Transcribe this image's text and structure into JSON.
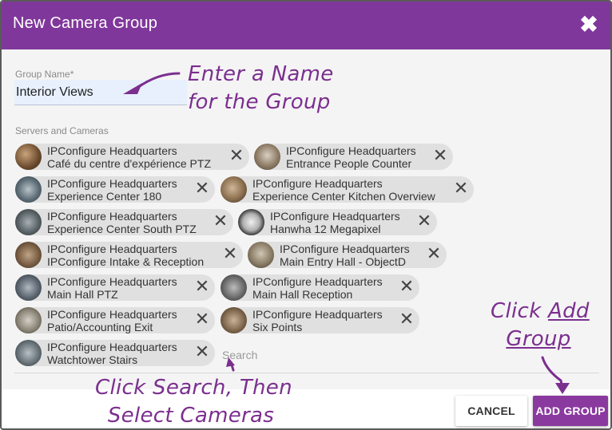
{
  "dialog": {
    "title": "New Camera Group",
    "close_icon": "close-icon"
  },
  "form": {
    "group_name_label": "Group Name",
    "group_name_required_mark": "*",
    "group_name_value": "Interior Views",
    "servers_label": "Servers and Cameras",
    "search_placeholder": "Search"
  },
  "cameras": [
    {
      "server": "IPConfigure Headquarters",
      "camera": "Café du centre d'expérience PTZ"
    },
    {
      "server": "IPConfigure Headquarters",
      "camera": "Entrance People Counter"
    },
    {
      "server": "IPConfigure Headquarters",
      "camera": "Experience Center 180"
    },
    {
      "server": "IPConfigure Headquarters",
      "camera": "Experience Center Kitchen Overview"
    },
    {
      "server": "IPConfigure Headquarters",
      "camera": "Experience Center South PTZ"
    },
    {
      "server": "IPConfigure Headquarters",
      "camera": "Hanwha 12 Megapixel"
    },
    {
      "server": "IPConfigure Headquarters",
      "camera": "IPConfigure Intake & Reception"
    },
    {
      "server": "IPConfigure Headquarters",
      "camera": "Main Entry Hall - ObjectD"
    },
    {
      "server": "IPConfigure Headquarters",
      "camera": "Main Hall PTZ"
    },
    {
      "server": "IPConfigure Headquarters",
      "camera": "Main Hall Reception"
    },
    {
      "server": "IPConfigure Headquarters",
      "camera": "Patio/Accounting Exit"
    },
    {
      "server": "IPConfigure Headquarters",
      "camera": "Six Points"
    },
    {
      "server": "IPConfigure Headquarters",
      "camera": "Watchtower Stairs"
    }
  ],
  "chip_remove_glyph": "✕",
  "buttons": {
    "cancel": "CANCEL",
    "add_group": "ADD GROUP"
  },
  "annotations": {
    "name_line1": "Enter a Name",
    "name_line2": "for the Group",
    "add_line1_prefix": "Click ",
    "add_line1_link": "Add",
    "add_line2": "Group",
    "search_line1": "Click Search, Then",
    "search_line2": "Select Cameras"
  },
  "colors": {
    "titlebar": "#80379b",
    "primary_button": "#8a3a9e",
    "annotation": "#7b2f8f",
    "chip": "#e0e0e0",
    "input_fill": "#e8f0fe"
  }
}
